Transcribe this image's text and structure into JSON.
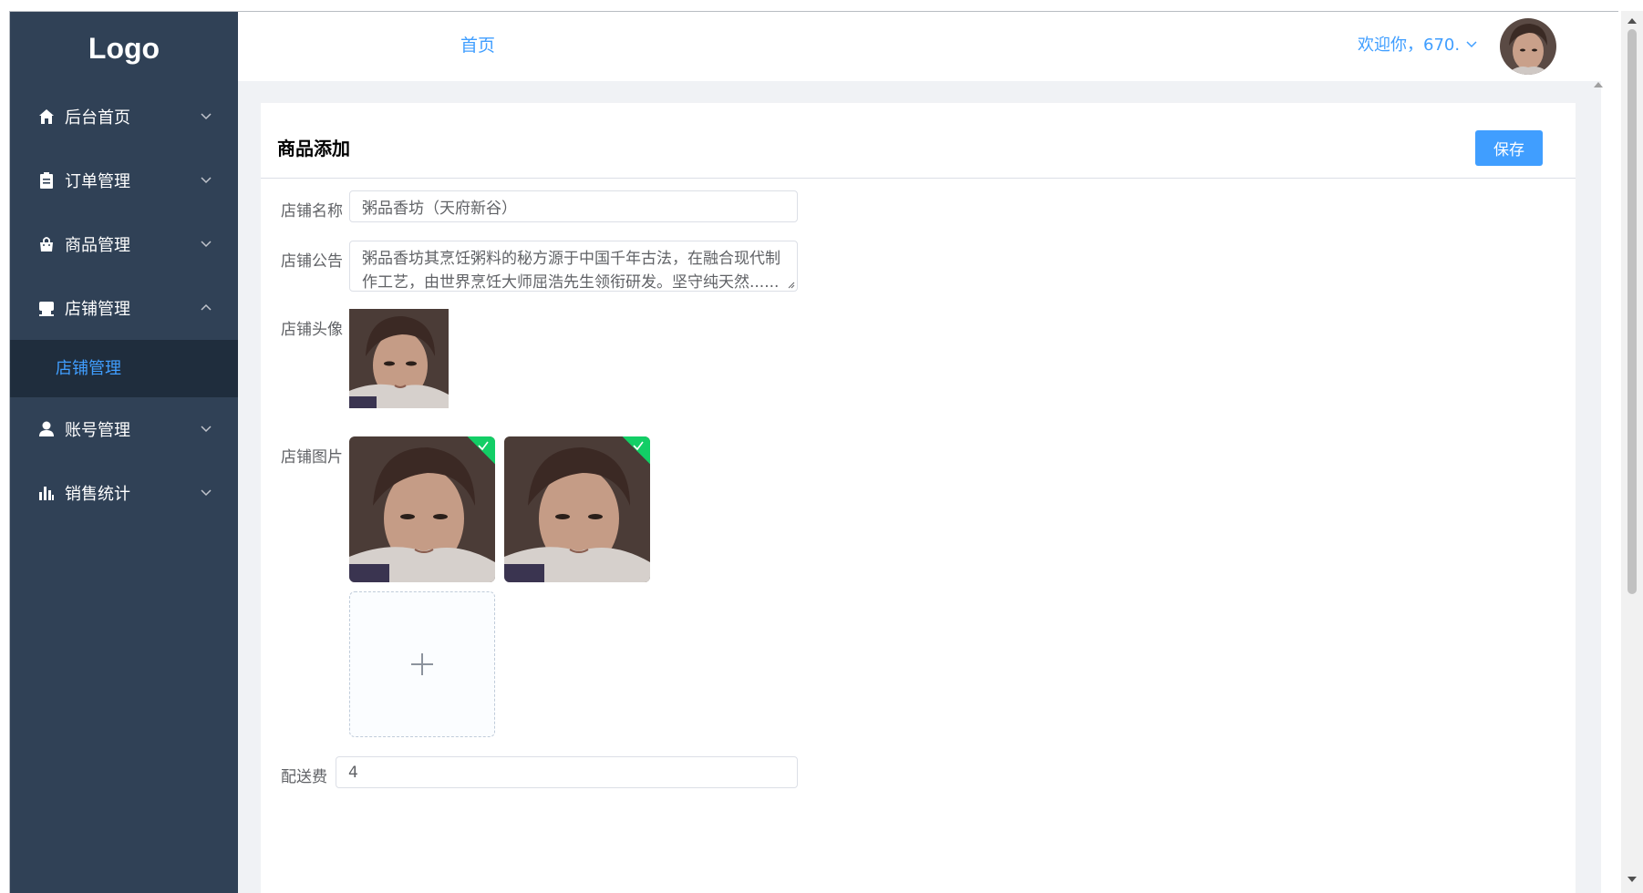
{
  "sidebar": {
    "logo": "Logo",
    "items": [
      {
        "label": "后台首页",
        "icon": "home-icon",
        "expanded": false
      },
      {
        "label": "订单管理",
        "icon": "clipboard-icon",
        "expanded": false
      },
      {
        "label": "商品管理",
        "icon": "shopping-bag-icon",
        "expanded": false
      },
      {
        "label": "店铺管理",
        "icon": "store-icon",
        "expanded": true
      },
      {
        "label": "账号管理",
        "icon": "user-icon",
        "expanded": false
      },
      {
        "label": "销售统计",
        "icon": "bar-chart-icon",
        "expanded": false
      }
    ],
    "submenu": {
      "label": "店铺管理",
      "active": true
    }
  },
  "header": {
    "nav_home": "首页",
    "welcome": "欢迎你，670.",
    "avatar_icon": "user-avatar"
  },
  "card": {
    "title": "商品添加",
    "save_label": "保存"
  },
  "form": {
    "shop_name_label": "店铺名称",
    "shop_name_value": "粥品香坊（天府新谷）",
    "notice_label": "店铺公告",
    "notice_value": "粥品香坊其烹饪粥料的秘方源于中国千年古法，在融合现代制作工艺，由世界烹饪大师屈浩先生领衔研发。坚守纯天然......",
    "avatar_label": "店铺头像",
    "images_label": "店铺图片",
    "images": [
      {
        "name": "shop-image-1",
        "uploaded": true
      },
      {
        "name": "shop-image-2",
        "uploaded": true
      }
    ],
    "upload_icon": "plus-icon",
    "delivery_label": "配送费",
    "delivery_value": "4"
  },
  "colors": {
    "sidebar_bg": "#304156",
    "submenu_bg": "#1f2d3d",
    "accent": "#409eff",
    "success": "#13ce66",
    "main_bg": "#f0f2f5"
  }
}
